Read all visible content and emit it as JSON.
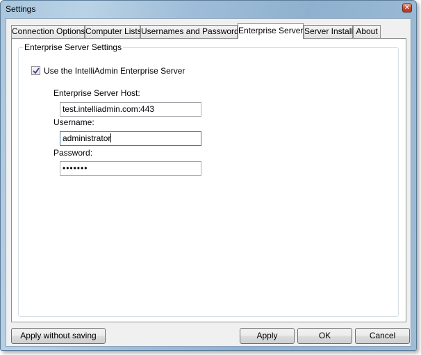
{
  "window": {
    "title": "Settings"
  },
  "tabs": [
    {
      "label": "Connection Options",
      "active": false
    },
    {
      "label": "Computer Lists",
      "active": false
    },
    {
      "label": "Usernames and Passwords",
      "active": false
    },
    {
      "label": "Enterprise Server",
      "active": true
    },
    {
      "label": "Server Install",
      "active": false
    },
    {
      "label": "About",
      "active": false
    }
  ],
  "group": {
    "title": "Enterprise Server Settings",
    "use_enterprise_label": "Use the IntelliAdmin Enterprise Server",
    "use_enterprise_checked": true,
    "host_label": "Enterprise Server Host:",
    "host_value": "test.intelliadmin.com:443",
    "username_label": "Username:",
    "username_value": "administrator",
    "password_label": "Password:",
    "password_value": "•••••••"
  },
  "buttons": {
    "apply_without_saving": "Apply without saving",
    "apply": "Apply",
    "ok": "OK",
    "cancel": "Cancel"
  },
  "icons": {
    "close": "close-icon",
    "check": "checkmark-icon"
  }
}
